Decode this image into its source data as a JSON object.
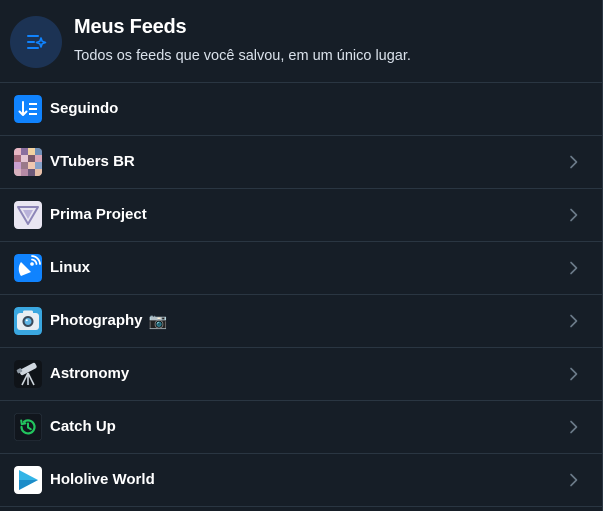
{
  "header": {
    "icon": "feeds-list-sparkle-icon",
    "title": "Meus Feeds",
    "subtitle": "Todos os feeds que você salvou, em um único lugar."
  },
  "colors": {
    "background": "#161e27",
    "divider": "#2a3642",
    "header_icon_bg": "#1c3354",
    "accent": "#1083fe",
    "chevron": "#6b7a89"
  },
  "feeds": [
    {
      "label": "Seguindo",
      "icon": "sort-down-icon"
    },
    {
      "label": "VTubers BR",
      "icon": "vtubers-collage-avatar"
    },
    {
      "label": "Prima Project",
      "icon": "prima-triangle-logo"
    },
    {
      "label": "Linux",
      "icon": "satellite-dish-icon"
    },
    {
      "label": "Photography",
      "emoji": "📷",
      "icon": "camera-logo"
    },
    {
      "label": "Astronomy",
      "icon": "telescope-icon"
    },
    {
      "label": "Catch Up",
      "icon": "history-clock-icon"
    },
    {
      "label": "Hololive World",
      "icon": "play-triangle-logo"
    }
  ]
}
